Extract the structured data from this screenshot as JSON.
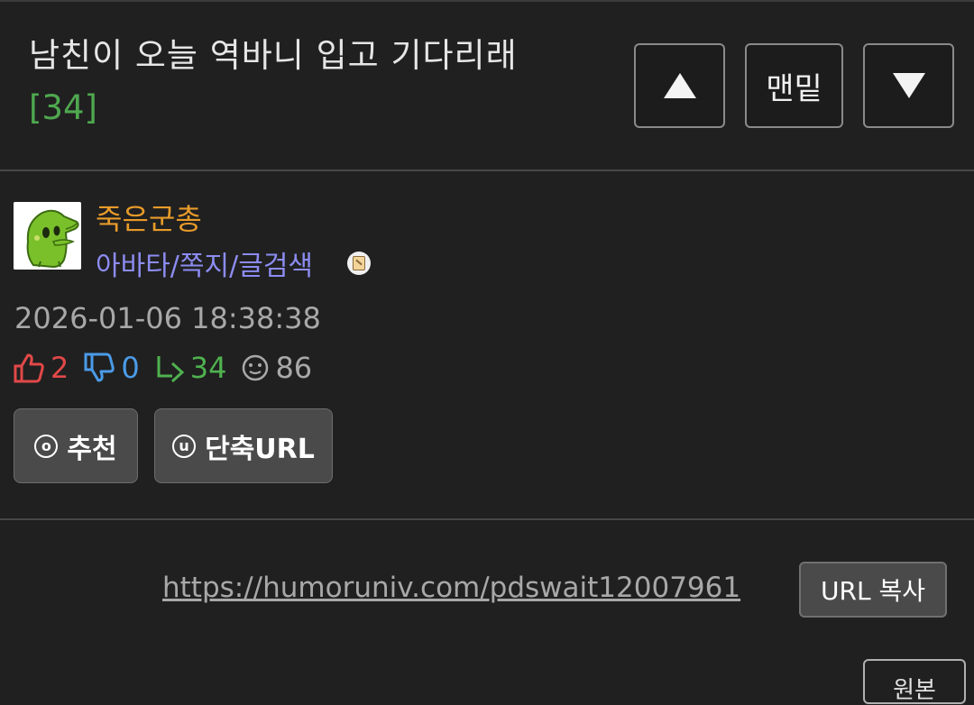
{
  "post": {
    "title": "남친이 오늘 역바니 입고 기다리래",
    "comment_count": "[34]"
  },
  "nav": {
    "up_icon": "triangle-up-icon",
    "bottom_label": "맨밑",
    "down_icon": "triangle-down-icon"
  },
  "author": {
    "name": "죽은군총",
    "links": "아바타/쪽지/글검색",
    "avatar_icon": "green-dinosaur-avatar",
    "badge_icon": "scroll-badge-icon"
  },
  "meta": {
    "date": "2026-01-06 18:38:38",
    "upvotes": "2",
    "downvotes": "0",
    "replies": "34",
    "views": "86"
  },
  "actions": {
    "recommend_icon": "o",
    "recommend_label": "추천",
    "shorturl_icon": "u",
    "shorturl_label": "단축URL"
  },
  "share": {
    "url": "https://humoruniv.com/pdswait12007961",
    "copy_label": "URL 복사",
    "original_label": "원본"
  },
  "colors": {
    "background": "#202020",
    "author_name": "#e89b2a",
    "author_links": "#8c8cf2",
    "comment_count": "#4fa84f",
    "upvote": "#e24848",
    "downvote": "#4a9be8",
    "reply": "#4fb24f"
  }
}
